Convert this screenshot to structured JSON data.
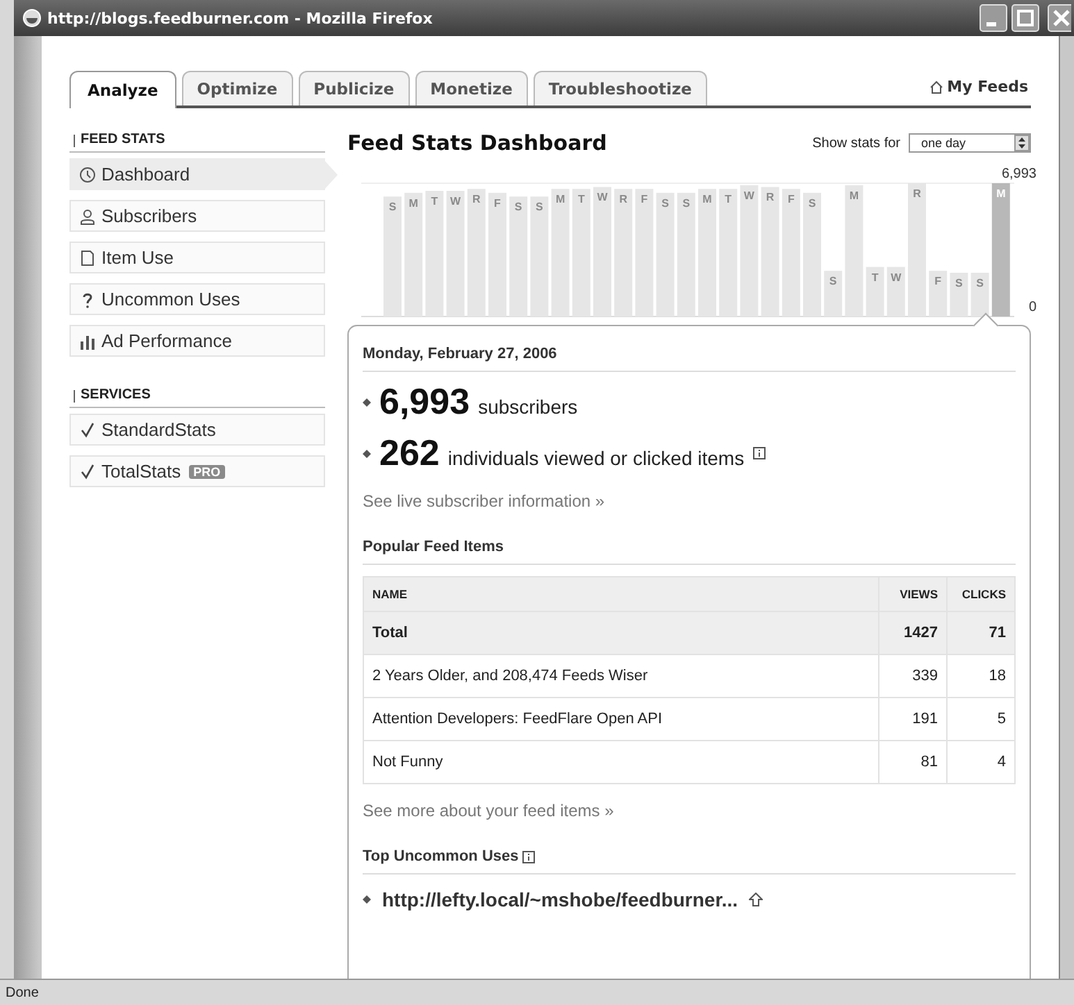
{
  "window": {
    "title": "http://blogs.feedburner.com - Mozilla Firefox"
  },
  "tabs": [
    {
      "label": "Analyze",
      "selected": true
    },
    {
      "label": "Optimize",
      "selected": false
    },
    {
      "label": "Publicize",
      "selected": false
    },
    {
      "label": "Monetize",
      "selected": false
    },
    {
      "label": "Troubleshootize",
      "selected": false
    }
  ],
  "my_feeds": "My Feeds",
  "sidebar": [
    {
      "heading": "FEED STATS",
      "items": [
        {
          "label": "Dashboard",
          "kind": "clock",
          "selected": true
        },
        {
          "label": "Subscribers",
          "kind": "person",
          "selected": false
        },
        {
          "label": "Item Use",
          "kind": "page",
          "selected": false
        },
        {
          "label": "Uncommon Uses",
          "kind": "question",
          "selected": false
        },
        {
          "label": "Ad Performance",
          "kind": "bars",
          "selected": false
        }
      ]
    },
    {
      "heading": "SERVICES",
      "items": [
        {
          "label": "StandardStats",
          "kind": "check",
          "selected": false
        },
        {
          "label": "TotalStats",
          "kind": "check",
          "selected": false,
          "badge": "PRO"
        }
      ]
    }
  ],
  "main": {
    "title": "Feed Stats Dashboard",
    "show_stats_label": "Show stats for",
    "period": "one day",
    "chart_data": {
      "type": "bar",
      "categories": [
        "S",
        "M",
        "T",
        "W",
        "R",
        "F",
        "S",
        "S",
        "M",
        "T",
        "W",
        "R",
        "F",
        "S",
        "S",
        "M",
        "T",
        "W",
        "R",
        "F",
        "S",
        "S",
        "M",
        "T",
        "W",
        "R",
        "F",
        "S",
        "S",
        "M"
      ],
      "series": [
        {
          "color": "#e6e6e6",
          "values": [
            6300,
            6500,
            6600,
            6600,
            6700,
            6500,
            6300,
            6300,
            6700,
            6700,
            6800,
            6700,
            6700,
            6500,
            6500,
            6700,
            6700,
            6900,
            6800,
            6700,
            6500,
            2400,
            6900,
            2600,
            2600,
            7000,
            2400,
            2300,
            2300,
            null
          ]
        },
        {
          "color": "#b8b8b8",
          "values": [
            null,
            null,
            null,
            null,
            null,
            null,
            null,
            null,
            null,
            null,
            null,
            null,
            null,
            null,
            null,
            null,
            null,
            null,
            null,
            null,
            null,
            null,
            null,
            null,
            null,
            null,
            null,
            null,
            null,
            7000
          ]
        }
      ],
      "stacked": true,
      "ylim": [
        0,
        7000
      ],
      "yticks": [
        {
          "value": 6993,
          "label": "6,993"
        },
        0
      ]
    },
    "date": "Monday, February 27, 2006",
    "stats": [
      {
        "value": "6,993",
        "label": "subscribers",
        "info": false
      },
      {
        "value": "262",
        "label": "individuals viewed or clicked items",
        "info": true
      }
    ],
    "live_link": "See live subscriber information »",
    "popular_heading": "Popular Feed Items",
    "table": {
      "columns": [
        "NAME",
        "VIEWS",
        "CLICKS"
      ],
      "rows": [
        {
          "kind": "total",
          "cells": [
            "Total",
            "1427",
            "71"
          ]
        },
        {
          "kind": "item",
          "cells": [
            "2 Years Older, and 208,474 Feeds Wiser",
            "339",
            "18"
          ]
        },
        {
          "kind": "item",
          "cells": [
            "Attention Developers: FeedFlare Open API",
            "191",
            "5"
          ]
        },
        {
          "kind": "item",
          "cells": [
            "Not Funny",
            "81",
            "4"
          ]
        }
      ]
    },
    "more_link": "See more about your feed items »",
    "uncommon_heading": "Top Uncommon Uses",
    "uncommon_info": true,
    "uncommon": [
      "http://lefty.local/~mshobe/feedburner..."
    ]
  },
  "status_bar": "Done"
}
